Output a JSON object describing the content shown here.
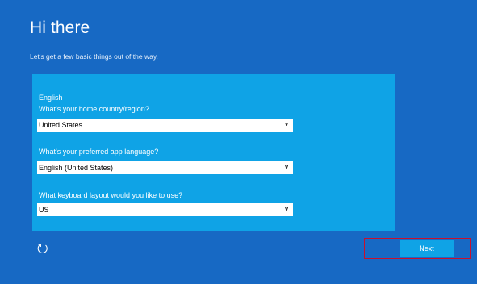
{
  "header": {
    "title": "Hi there",
    "subtitle": "Let's get a few basic things out of the way."
  },
  "panel": {
    "language_heading": "English",
    "country": {
      "label": "What's your home country/region?",
      "value": "United States"
    },
    "app_language": {
      "label": "What's your preferred app language?",
      "value": "English (United States)"
    },
    "keyboard": {
      "label": "What keyboard layout would you like to use?",
      "value": "US"
    }
  },
  "footer": {
    "next_label": "Next"
  },
  "colors": {
    "background": "#1769c4",
    "panel": "#0fa3e6",
    "next_button": "#0fa3e6",
    "focus_outline": "#c8102e"
  },
  "icons": {
    "restart": "restart-icon",
    "dropdown": "chevron-down-icon"
  }
}
